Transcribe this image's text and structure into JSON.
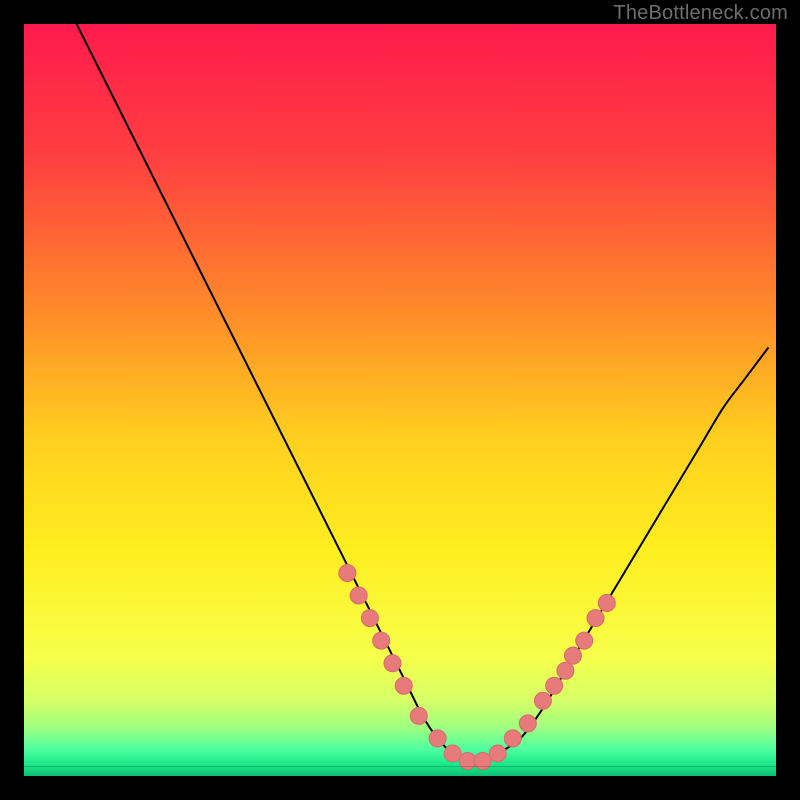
{
  "attribution": "TheBottleneck.com",
  "colors": {
    "black": "#000000",
    "curve": "#000000",
    "marker_fill": "#e77b7b",
    "marker_stroke": "#d86a6a"
  },
  "chart_data": {
    "type": "line",
    "title": "",
    "xlabel": "",
    "ylabel": "",
    "xlim": [
      0,
      100
    ],
    "ylim": [
      0,
      100
    ],
    "background_gradient": {
      "stops": [
        {
          "pos": 0.0,
          "color": "#ff1a4d"
        },
        {
          "pos": 0.18,
          "color": "#ff4040"
        },
        {
          "pos": 0.38,
          "color": "#ff8a29"
        },
        {
          "pos": 0.55,
          "color": "#ffcf1f"
        },
        {
          "pos": 0.7,
          "color": "#ffee20"
        },
        {
          "pos": 0.84,
          "color": "#f7ff4a"
        },
        {
          "pos": 0.9,
          "color": "#d6ff66"
        },
        {
          "pos": 0.935,
          "color": "#9fff80"
        },
        {
          "pos": 0.965,
          "color": "#4dffa0"
        },
        {
          "pos": 0.985,
          "color": "#19e88a"
        },
        {
          "pos": 1.0,
          "color": "#0fbf72"
        }
      ]
    },
    "series": [
      {
        "name": "bottleneck-curve",
        "x": [
          7,
          10,
          13,
          16,
          19,
          22,
          25,
          28,
          31,
          34,
          37,
          40,
          43,
          46,
          49,
          51,
          53,
          55,
          57,
          59,
          61,
          63,
          66,
          69,
          72,
          75,
          78,
          81,
          84,
          87,
          90,
          93,
          96,
          99
        ],
        "y": [
          100,
          94,
          88,
          82,
          76,
          70,
          64,
          58,
          52,
          46,
          40,
          34,
          28,
          22,
          16,
          12,
          8,
          5,
          3,
          2,
          2,
          3,
          5,
          9,
          14,
          19,
          24,
          29,
          34,
          39,
          44,
          49,
          53,
          57
        ]
      }
    ],
    "markers": {
      "name": "highlighted-points",
      "points": [
        {
          "x": 43.0,
          "y": 27
        },
        {
          "x": 44.5,
          "y": 24
        },
        {
          "x": 46.0,
          "y": 21
        },
        {
          "x": 47.5,
          "y": 18
        },
        {
          "x": 49.0,
          "y": 15
        },
        {
          "x": 50.5,
          "y": 12
        },
        {
          "x": 52.5,
          "y": 8
        },
        {
          "x": 55.0,
          "y": 5
        },
        {
          "x": 57.0,
          "y": 3
        },
        {
          "x": 59.0,
          "y": 2
        },
        {
          "x": 61.0,
          "y": 2
        },
        {
          "x": 63.0,
          "y": 3
        },
        {
          "x": 65.0,
          "y": 5
        },
        {
          "x": 67.0,
          "y": 7
        },
        {
          "x": 69.0,
          "y": 10
        },
        {
          "x": 70.5,
          "y": 12
        },
        {
          "x": 72.0,
          "y": 14
        },
        {
          "x": 73.0,
          "y": 16
        },
        {
          "x": 74.5,
          "y": 18
        },
        {
          "x": 76.0,
          "y": 21
        },
        {
          "x": 77.5,
          "y": 23
        }
      ]
    }
  }
}
